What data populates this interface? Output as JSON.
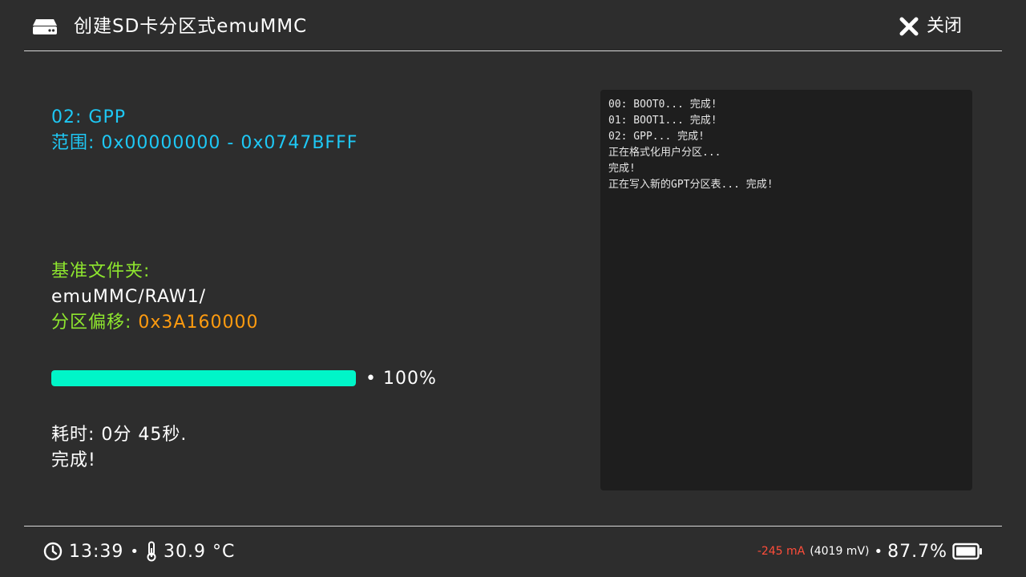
{
  "header": {
    "title": "创建SD卡分区式emuMMC",
    "close_label": "关闭",
    "app_icon": "drive-icon",
    "close_icon": "x-icon"
  },
  "info": {
    "partition": "02: GPP",
    "range": "范围: 0x00000000 - 0x0747BFFF",
    "base_folder_label": "基准文件夹:",
    "base_folder_value": "emuMMC/RAW1/",
    "offset_label": "分区偏移: ",
    "offset_value": "0x3A160000",
    "elapsed": "耗时: 0分 45秒.",
    "status": "完成!"
  },
  "progress": {
    "value": 100,
    "label": "• 100%",
    "color": "#00f5c8"
  },
  "log": {
    "lines": [
      "00: BOOT0... 完成!",
      "01: BOOT1... 完成!",
      "02: GPP... 完成!",
      "正在格式化用户分区...",
      "完成!",
      "正在写入新的GPT分区表... 完成!"
    ]
  },
  "footer": {
    "time": "13:39",
    "separator": "•",
    "temperature": "30.9 °C",
    "current": "-245 mA",
    "voltage": "(4019 mV)",
    "battery": "87.7%",
    "clock_icon": "clock-icon",
    "thermometer_icon": "thermometer-icon",
    "battery_icon": "battery-icon"
  },
  "colors": {
    "background": "#2d2d2d",
    "accent_cyan": "#1ec8f5",
    "accent_green": "#8ee62e",
    "accent_orange": "#ff9b0f",
    "current_red": "#ff4d3a"
  }
}
